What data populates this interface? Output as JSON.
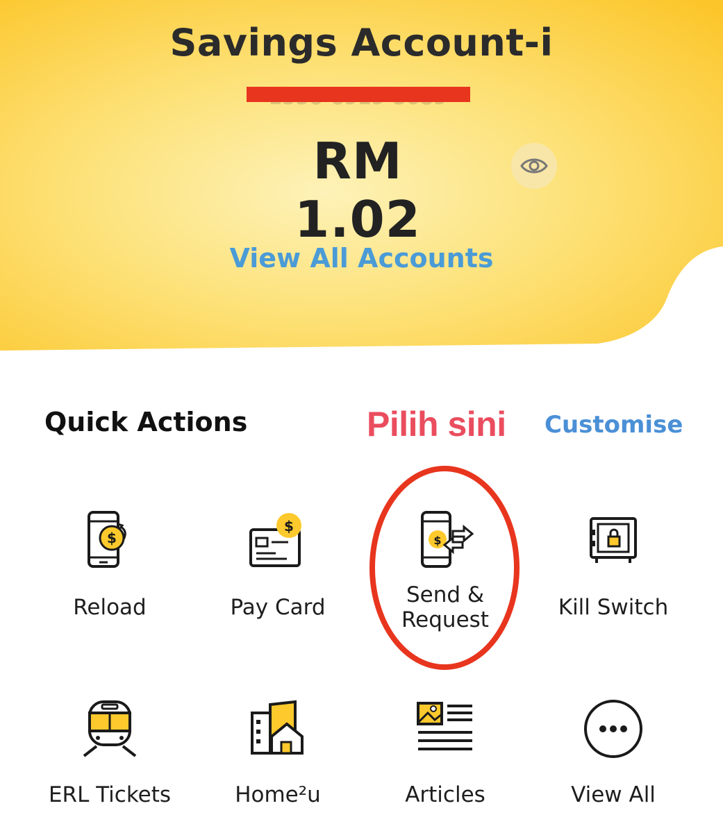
{
  "account": {
    "name": "Savings Account-i",
    "number_masked": "1556-6919-5089",
    "balance": "RM 1.02",
    "view_all_label": "View All Accounts",
    "eye_icon": "eye-icon"
  },
  "annotation": {
    "pointer_text": "Pilih sini",
    "color": "#e8351e"
  },
  "quick_actions": {
    "title": "Quick Actions",
    "customise_label": "Customise",
    "items": [
      {
        "label": "Reload",
        "icon": "phone-reload-icon"
      },
      {
        "label": "Pay Card",
        "icon": "credit-card-icon"
      },
      {
        "label_line1": "Send &",
        "label_line2": "Request",
        "icon": "phone-transfer-icon"
      },
      {
        "label": "Kill Switch",
        "icon": "safe-lock-icon"
      },
      {
        "label": "ERL Tickets",
        "icon": "train-icon"
      },
      {
        "label": "Home²u",
        "icon": "home-building-icon"
      },
      {
        "label": "Articles",
        "icon": "article-icon"
      },
      {
        "label": "View All",
        "icon": "more-dots-icon"
      }
    ]
  },
  "colors": {
    "brand_yellow": "#fdc92c",
    "link_blue": "#4a9bd6",
    "annotation_red": "#e8351e",
    "annotation_pink": "#ea4d5e"
  }
}
